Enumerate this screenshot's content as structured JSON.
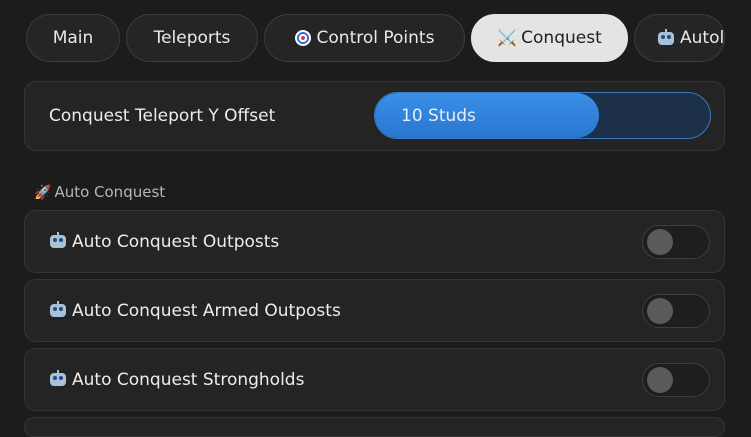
{
  "tabs": [
    {
      "label": "Main",
      "icon": ""
    },
    {
      "label": "Teleports",
      "icon": ""
    },
    {
      "label": "Control Points",
      "icon": "target-icon"
    },
    {
      "label": "Conquest",
      "icon": "crossed-swords-icon",
      "glyph": "⚔️",
      "active": true
    },
    {
      "label": "Autol",
      "icon": "robot-icon"
    }
  ],
  "offset_setting": {
    "label": "Conquest Teleport Y Offset",
    "value_text": "10 Studs",
    "fill_fraction": 0.67
  },
  "section": {
    "title": "Auto Conquest",
    "icon": "rocket-icon",
    "glyph": "🚀"
  },
  "toggles": [
    {
      "label": "Auto Conquest Outposts",
      "icon": "robot-icon",
      "on": false
    },
    {
      "label": "Auto Conquest Armed Outposts",
      "icon": "robot-icon",
      "on": false
    },
    {
      "label": "Auto Conquest Strongholds",
      "icon": "robot-icon",
      "on": false
    }
  ],
  "colors": {
    "background": "#1c1c1c",
    "card": "#242424",
    "active_tab": "#e4e4e4",
    "slider_fill": "#3a8fe6",
    "slider_track": "#1d3049"
  }
}
